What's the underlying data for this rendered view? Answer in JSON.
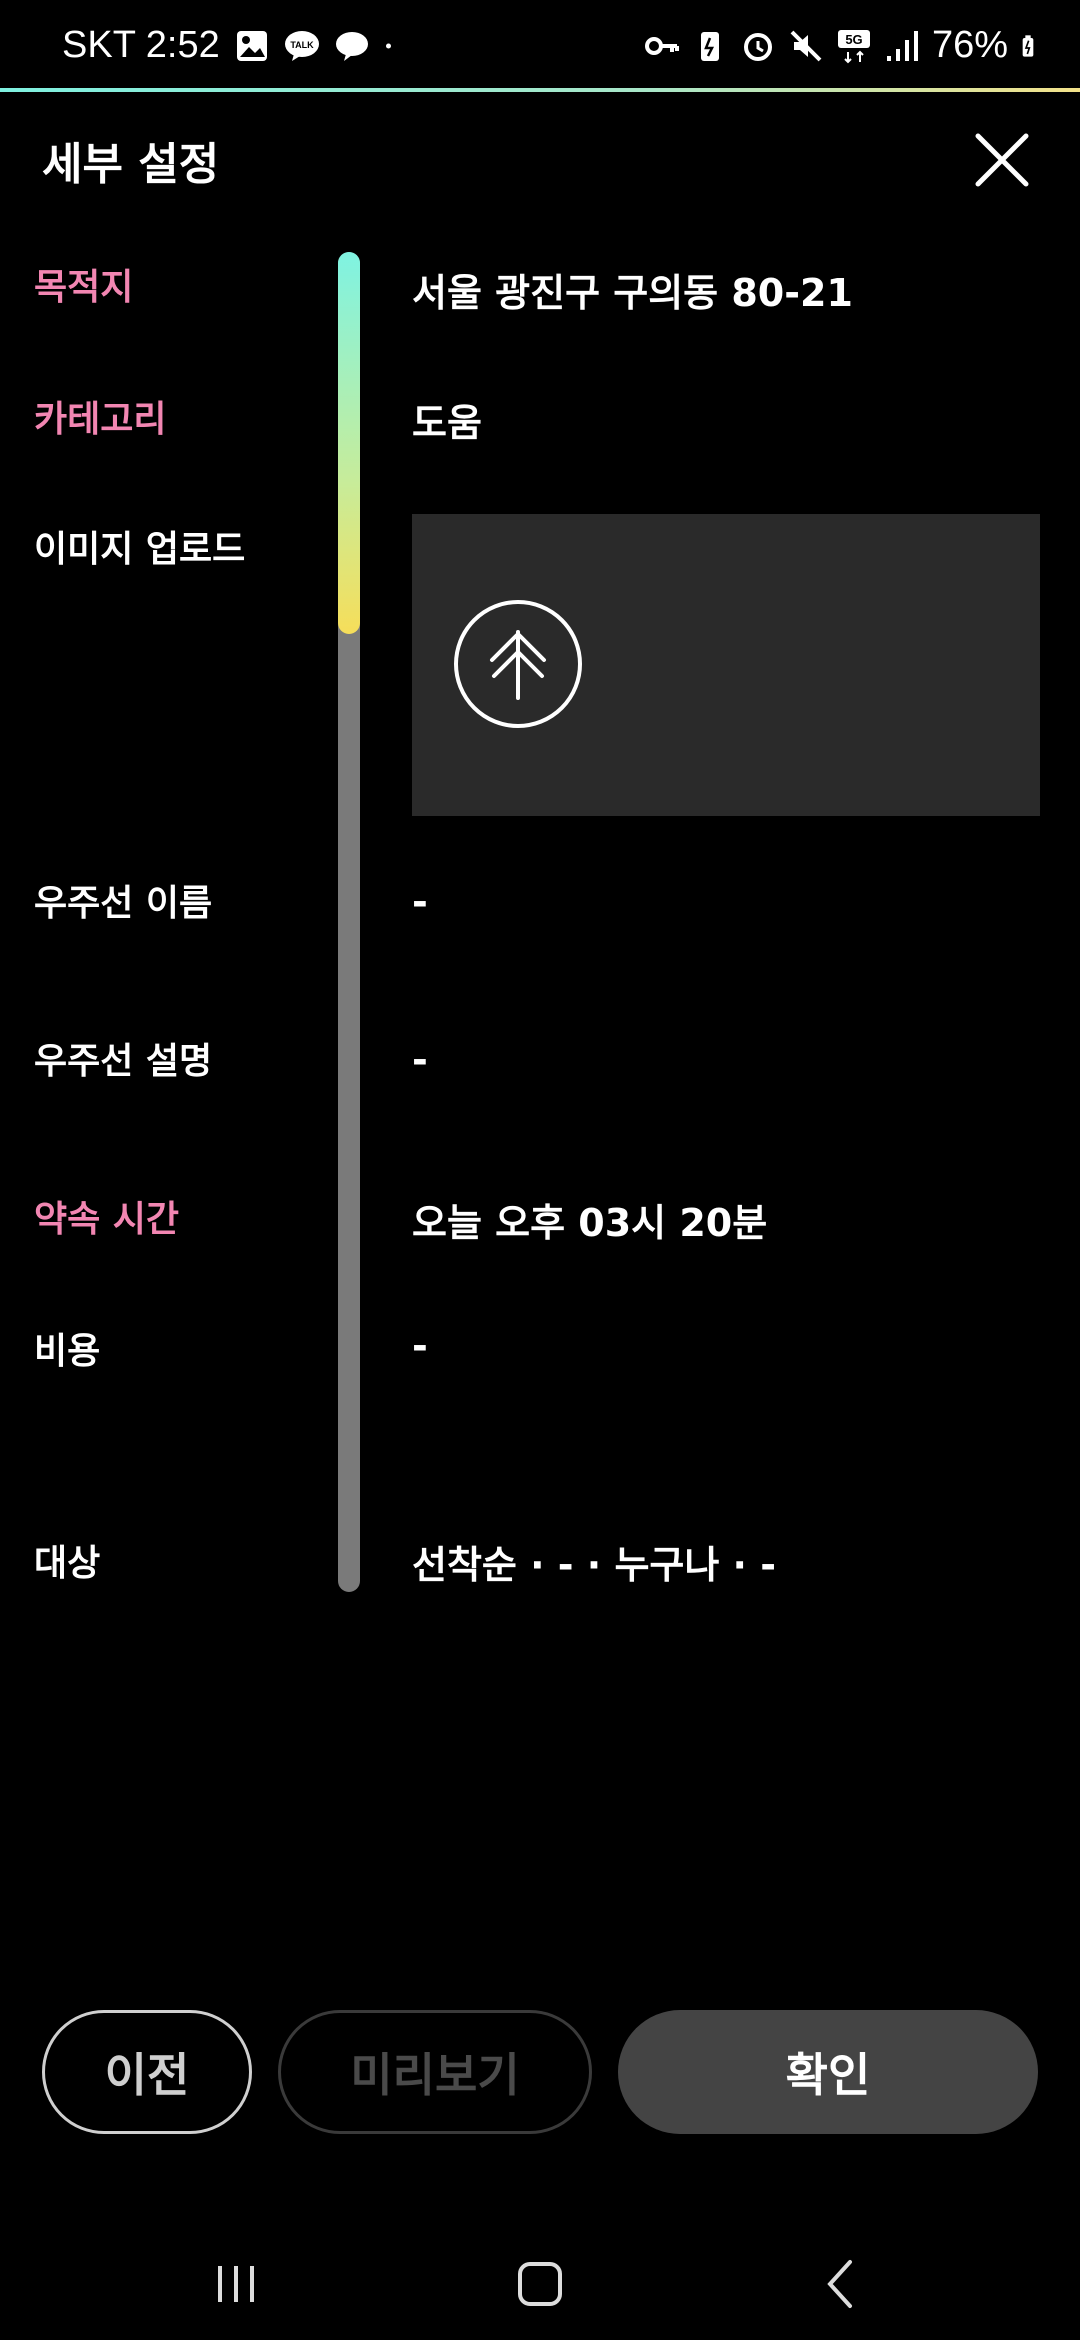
{
  "status": {
    "carrier_time": "SKT 2:52",
    "battery": "76%",
    "left_icons": [
      "gallery-icon",
      "kakao-talk-icon",
      "chat-bubble-icon",
      "dot-icon"
    ],
    "right_icons": [
      "key-icon",
      "battery-saver-icon",
      "alarm-icon",
      "mute-icon",
      "5g-icon",
      "signal-icon",
      "battery-icon"
    ]
  },
  "header": {
    "title": "세부 설정"
  },
  "rows": [
    {
      "label": "목적지",
      "value": "서울 광진구 구의동 80-21",
      "highlight": true
    },
    {
      "label": "카테고리",
      "value": "도움",
      "highlight": true
    },
    {
      "label": "이미지 업로드",
      "value": "",
      "highlight": false
    },
    {
      "label": "우주선 이름",
      "value": "-",
      "highlight": false
    },
    {
      "label": "우주선 설명",
      "value": "-",
      "highlight": false
    },
    {
      "label": "약속 시간",
      "value": "오늘 오후 03시 20분",
      "highlight": true
    },
    {
      "label": "비용",
      "value": "-",
      "highlight": false
    },
    {
      "label": "대상",
      "value": "선착순 · - · 누구나 · -",
      "highlight": false
    }
  ],
  "progress": {
    "fraction": 0.285
  },
  "buttons": {
    "prev": "이전",
    "preview": "미리보기",
    "confirm": "확인"
  },
  "colors": {
    "highlight": "#f286b2",
    "background": "#000000",
    "confirm_bg": "#444444"
  }
}
